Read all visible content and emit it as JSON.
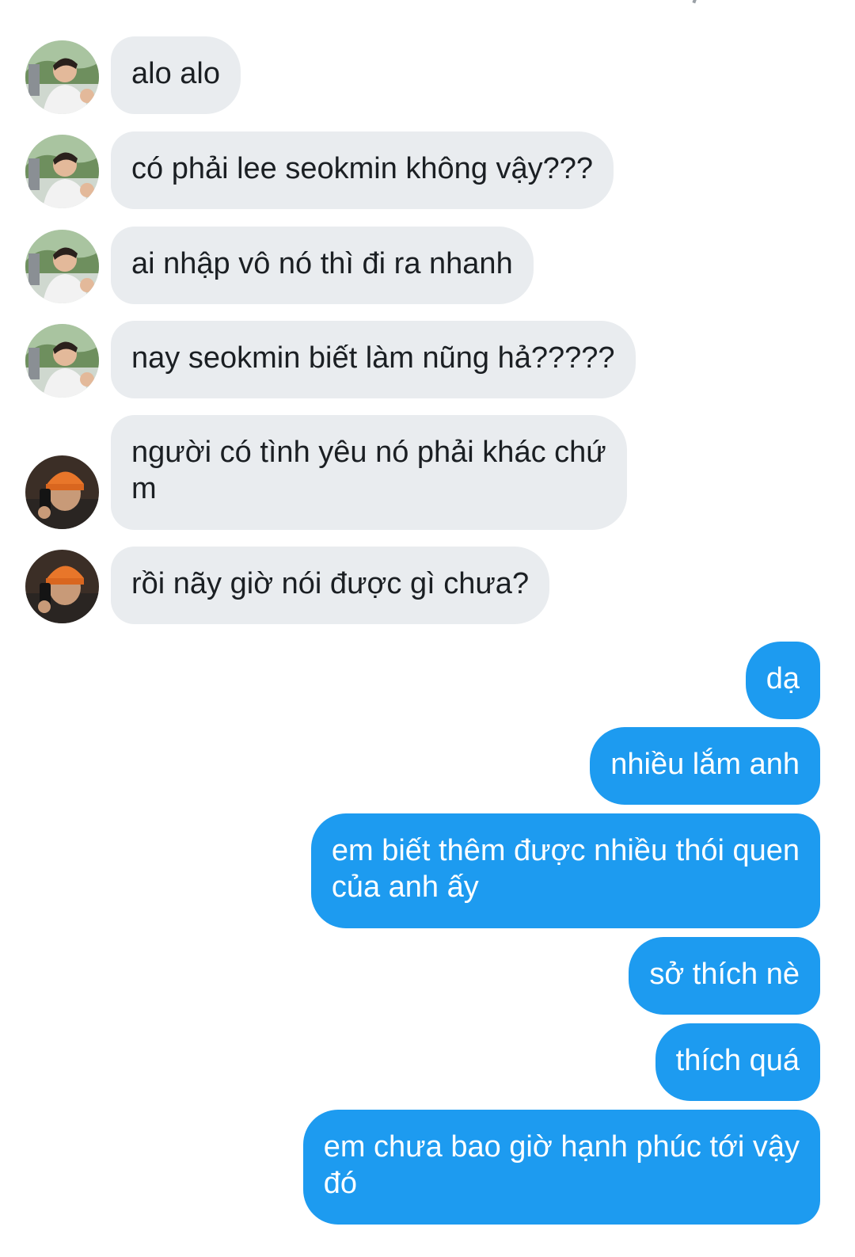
{
  "incoming_messages": [
    {
      "text": "alo alo",
      "avatar": "user-a-avatar"
    },
    {
      "text": "có phải lee seokmin không vậy???",
      "avatar": "user-a-avatar"
    },
    {
      "text": "ai nhập vô nó thì đi ra nhanh",
      "avatar": "user-a-avatar"
    },
    {
      "text": "nay seokmin biết làm nũng hả?????",
      "avatar": "user-a-avatar"
    },
    {
      "text": "người có tình yêu nó phải khác chứ\nm",
      "avatar": "user-b-avatar"
    },
    {
      "text": "rồi nãy giờ nói được gì chưa?",
      "avatar": "user-b-avatar"
    }
  ],
  "outgoing_messages": [
    {
      "text": "dạ"
    },
    {
      "text": "nhiều lắm anh"
    },
    {
      "text": "em biết thêm được nhiều thói quen\ncủa anh ấy"
    },
    {
      "text": "sở thích nè"
    },
    {
      "text": "thích quá"
    },
    {
      "text": "em chưa bao giờ hạnh phúc tới vậy\nđó"
    }
  ],
  "colors": {
    "incoming_bubble": "#e9ecef",
    "outgoing_bubble": "#1d9bf0",
    "incoming_text": "#1b1f23",
    "outgoing_text": "#ffffff"
  }
}
